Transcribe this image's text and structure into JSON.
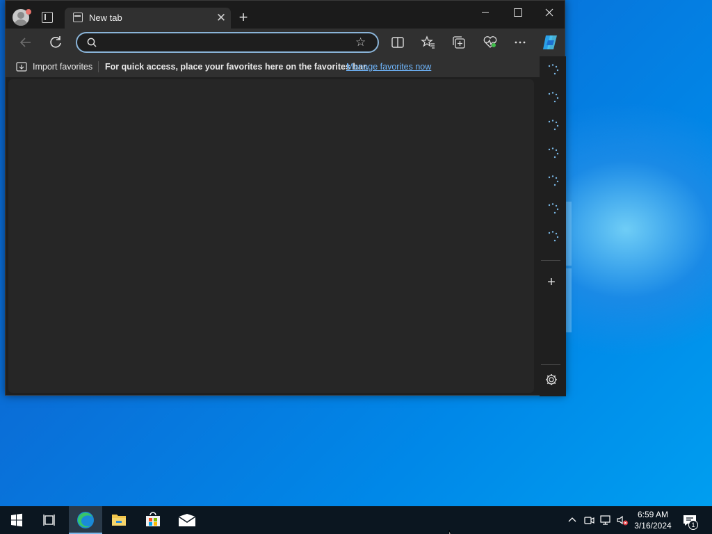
{
  "browser": {
    "tab": {
      "title": "New tab",
      "close": "✕"
    },
    "new_tab": "+",
    "address_bar": {
      "value": "",
      "placeholder": ""
    },
    "favorites_bar": {
      "import_label": "Import favorites",
      "message": "For quick access, place your favorites here on the favorites bar.",
      "link": "Manage favorites now"
    },
    "sidebar": {
      "add": "+"
    }
  },
  "taskbar": {
    "clock": {
      "time": "6:59 AM",
      "date": "3/16/2024"
    },
    "notification_count": "1"
  },
  "colors": {
    "accent": "#70b8ff",
    "window_bg": "#1f1f1f",
    "toolbar_bg": "#303030",
    "desktop": "#0078d7"
  },
  "icons": [
    "profile-icon",
    "workspaces-icon",
    "new-tab-page-icon",
    "close-icon",
    "plus-icon",
    "minimize-icon",
    "maximize-icon",
    "back-arrow-icon",
    "refresh-icon",
    "search-icon",
    "star-icon",
    "split-screen-icon",
    "favorites-icon",
    "collections-icon",
    "browser-essentials-icon",
    "more-icon",
    "copilot-icon",
    "import-icon",
    "loading-spinner-icon",
    "gear-icon",
    "windows-logo-icon",
    "task-view-icon",
    "edge-icon",
    "file-explorer-icon",
    "store-icon",
    "mail-icon",
    "chevron-up-icon",
    "meet-now-icon",
    "network-icon",
    "volume-muted-icon",
    "notification-icon"
  ]
}
